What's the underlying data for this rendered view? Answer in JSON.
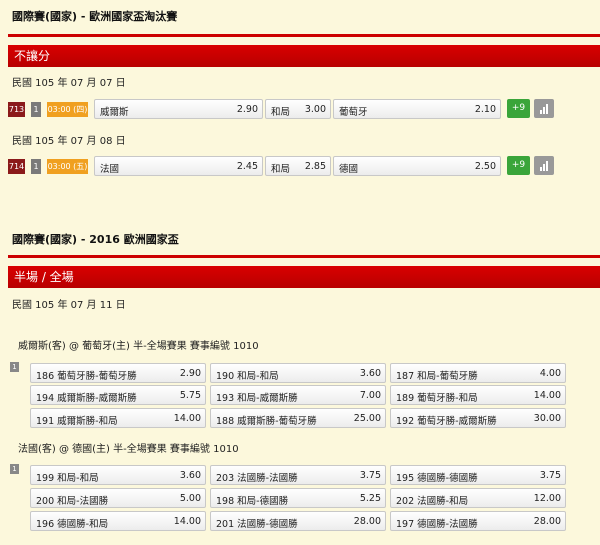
{
  "section1": {
    "title": "國際賽(國家) - 歐洲國家盃淘汰賽",
    "bar": "不讓分",
    "matches": [
      {
        "date": "民國 105 年 07 月 07 日",
        "code": "713",
        "group": "1",
        "time": "03:00 (四)",
        "home": "威爾斯",
        "home_odds": "2.90",
        "draw": "和局",
        "draw_odds": "3.00",
        "away": "葡萄牙",
        "away_odds": "2.10",
        "more": "+9"
      },
      {
        "date": "民國 105 年 07 月 08 日",
        "code": "714",
        "group": "1",
        "time": "03:00 (五)",
        "home": "法國",
        "home_odds": "2.45",
        "draw": "和局",
        "draw_odds": "2.85",
        "away": "德國",
        "away_odds": "2.50",
        "more": "+9"
      }
    ]
  },
  "section2": {
    "title": "國際賽(國家) - 2016 歐洲國家盃",
    "bar": "半場 / 全場",
    "date": "民國 105 年 07 月 11 日",
    "groups": [
      {
        "header": "威爾斯(客) @ 葡萄牙(主) 半-全場賽果 賽事編號 1010",
        "group": "1",
        "rows": [
          [
            {
              "label": "186 葡萄牙勝-葡萄牙勝",
              "odds": "2.90"
            },
            {
              "label": "190 和局-和局",
              "odds": "3.60"
            },
            {
              "label": "187 和局-葡萄牙勝",
              "odds": "4.00"
            }
          ],
          [
            {
              "label": "194 威爾斯勝-威爾斯勝",
              "odds": "5.75"
            },
            {
              "label": "193 和局-威爾斯勝",
              "odds": "7.00"
            },
            {
              "label": "189 葡萄牙勝-和局",
              "odds": "14.00"
            }
          ],
          [
            {
              "label": "191 威爾斯勝-和局",
              "odds": "14.00"
            },
            {
              "label": "188 威爾斯勝-葡萄牙勝",
              "odds": "25.00"
            },
            {
              "label": "192 葡萄牙勝-威爾斯勝",
              "odds": "30.00"
            }
          ]
        ]
      },
      {
        "header": "法國(客) @ 德國(主) 半-全場賽果 賽事編號 1010",
        "group": "1",
        "rows": [
          [
            {
              "label": "199 和局-和局",
              "odds": "3.60"
            },
            {
              "label": "203 法國勝-法國勝",
              "odds": "3.75"
            },
            {
              "label": "195 德國勝-德國勝",
              "odds": "3.75"
            }
          ],
          [
            {
              "label": "200 和局-法國勝",
              "odds": "5.00"
            },
            {
              "label": "198 和局-德國勝",
              "odds": "5.25"
            },
            {
              "label": "202 法國勝-和局",
              "odds": "12.00"
            }
          ],
          [
            {
              "label": "196 德國勝-和局",
              "odds": "14.00"
            },
            {
              "label": "201 法國勝-德國勝",
              "odds": "28.00"
            },
            {
              "label": "197 德國勝-法國勝",
              "odds": "28.00"
            }
          ]
        ]
      }
    ]
  }
}
